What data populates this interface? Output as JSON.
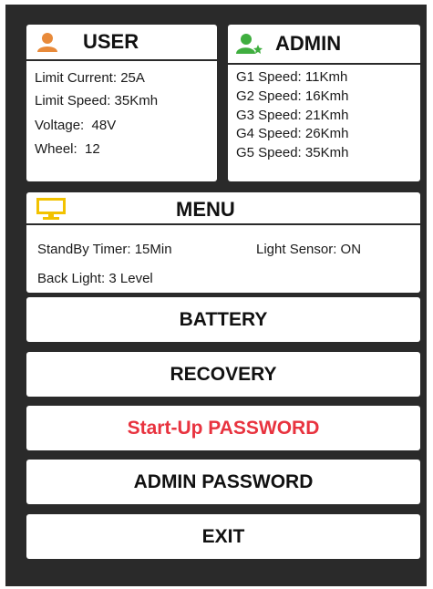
{
  "user": {
    "title": "USER",
    "icon": "user-icon",
    "icon_color": "#e88a3a",
    "lines": [
      "Limit Current: 25A",
      "Limit Speed: 35Kmh",
      "Voltage:  48V",
      "Wheel:  12"
    ]
  },
  "admin": {
    "title": "ADMIN",
    "icon": "admin-user-icon",
    "icon_color": "#3fae3f",
    "lines": [
      "G1 Speed: 11Kmh",
      "G2 Speed: 16Kmh",
      "G3 Speed: 21Kmh",
      "G4 Speed: 26Kmh",
      "G5 Speed: 35Kmh"
    ]
  },
  "menu": {
    "title": "MENU",
    "icon": "monitor-icon",
    "icon_color": "#f2c200",
    "standby": "StandBy Timer: 15Min",
    "light_sensor": "Light Sensor: ON",
    "back_light": "Back Light: 3 Level"
  },
  "buttons": {
    "battery": "BATTERY",
    "recovery": "RECOVERY",
    "startup_password": "Start-Up PASSWORD",
    "admin_password": "ADMIN PASSWORD",
    "exit": "EXIT"
  },
  "colors": {
    "background": "#2a2a2a",
    "panel": "#ffffff",
    "highlight_text": "#e8333f"
  }
}
